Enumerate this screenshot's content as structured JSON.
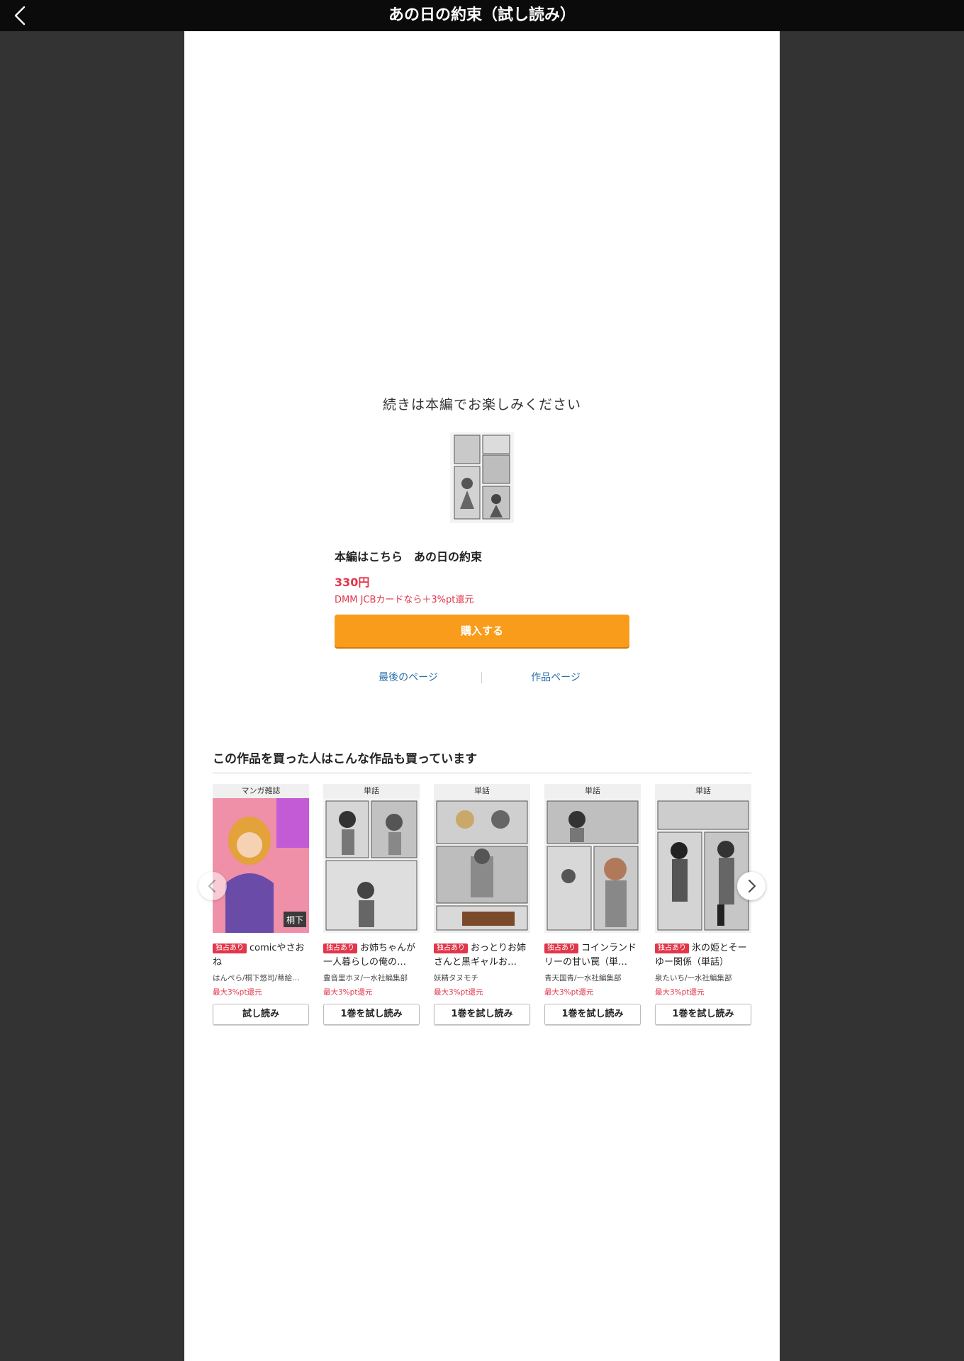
{
  "header": {
    "title": "あの日の約束（試し読み）"
  },
  "main": {
    "continue_message": "続きは本編でお楽しみください",
    "product_title": "本編はこちら　あの日の約束",
    "price": "330円",
    "point_note": "DMM JCBカードなら＋3%pt還元",
    "buy_label": "購入する",
    "last_page_link": "最後のページ",
    "work_page_link": "作品ページ"
  },
  "recommend": {
    "heading": "この作品を買った人はこんな作品も買っています",
    "items": [
      {
        "label": "マンガ雑誌",
        "badge": "独占あり",
        "title": "comicやさおね",
        "author": "はんぺら/桐下悠司/蒂絵…",
        "pt": "最大3%pt還元",
        "button": "試し読み",
        "cover_color": "#ef8fa8"
      },
      {
        "label": "単話",
        "badge": "独占あり",
        "title": "お姉ちゃんが一人暮らしの俺の…",
        "author": "豊音里ホヌ/一水社編集部",
        "pt": "最大3%pt還元",
        "button": "1巻を試し読み",
        "cover_color": "#d8d8d8"
      },
      {
        "label": "単話",
        "badge": "独占あり",
        "title": "おっとりお姉さんと黒ギャルお…",
        "author": "妖精タヌモチ",
        "pt": "最大3%pt還元",
        "button": "1巻を試し読み",
        "cover_color": "#cfcfcf"
      },
      {
        "label": "単話",
        "badge": "独占あり",
        "title": "コインランドリーの甘い罠（単…",
        "author": "青天国青/一水社編集部",
        "pt": "最大3%pt還元",
        "button": "1巻を試し読み",
        "cover_color": "#d4d4d4"
      },
      {
        "label": "単話",
        "badge": "独占あり",
        "title": "氷の姫とそーゆー関係（単話）",
        "author": "泉たいち/一水社編集部",
        "pt": "最大3%pt還元",
        "button": "1巻を試し読み",
        "cover_color": "#d0d0d0"
      }
    ]
  },
  "icons": {
    "back": "chevron-left-icon",
    "prev": "chevron-left-icon",
    "next": "chevron-right-icon"
  }
}
